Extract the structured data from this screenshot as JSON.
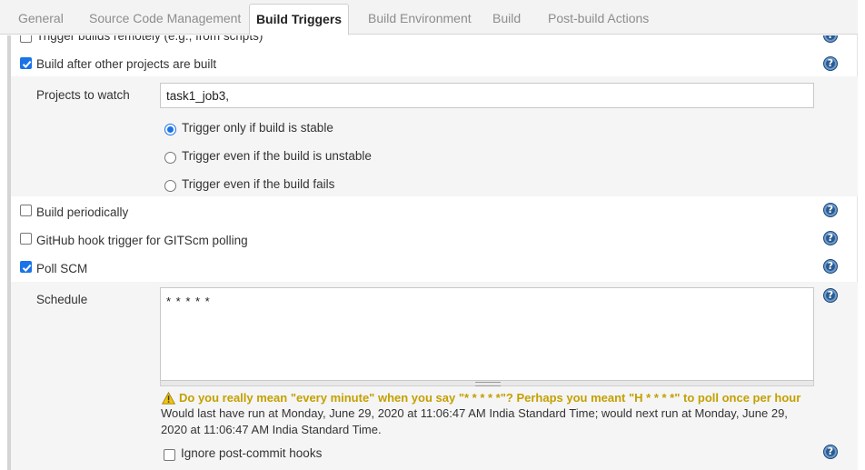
{
  "tabs": [
    {
      "label": "General"
    },
    {
      "label": "Source Code Management"
    },
    {
      "label": "Build Triggers"
    },
    {
      "label": "Build Environment"
    },
    {
      "label": "Build"
    },
    {
      "label": "Post-build Actions"
    }
  ],
  "triggers": {
    "remote": {
      "label": "Trigger builds remotely (e.g., from scripts)",
      "checked": false
    },
    "after_other": {
      "label": "Build after other projects are built",
      "checked": true
    },
    "periodic": {
      "label": "Build periodically",
      "checked": false
    },
    "github_hook": {
      "label": "GitHub hook trigger for GITScm polling",
      "checked": false
    },
    "poll_scm": {
      "label": "Poll SCM",
      "checked": true
    }
  },
  "projects": {
    "label": "Projects to watch",
    "value": "task1_job3,",
    "options": [
      {
        "label": "Trigger only if build is stable",
        "selected": true
      },
      {
        "label": "Trigger even if the build is unstable",
        "selected": false
      },
      {
        "label": "Trigger even if the build fails",
        "selected": false
      }
    ]
  },
  "schedule": {
    "label": "Schedule",
    "value": "* * * * *",
    "warning": "Do you really mean \"every minute\" when you say \"* * * * *\"? Perhaps you meant \"H * * * *\" to poll once per hour",
    "info_line1": "Would last have run at Monday, June 29, 2020 at 11:06:47 AM India Standard Time; would next run at Monday, June 29,",
    "info_line2": "2020 at 11:06:47 AM India Standard Time."
  },
  "ignore_hooks": {
    "label": "Ignore post-commit hooks",
    "checked": false
  },
  "help": {
    "symbol": "?"
  },
  "colors": {
    "accent": "#1a73e8",
    "warning": "#c4a000",
    "help": "#2b5a8f"
  }
}
